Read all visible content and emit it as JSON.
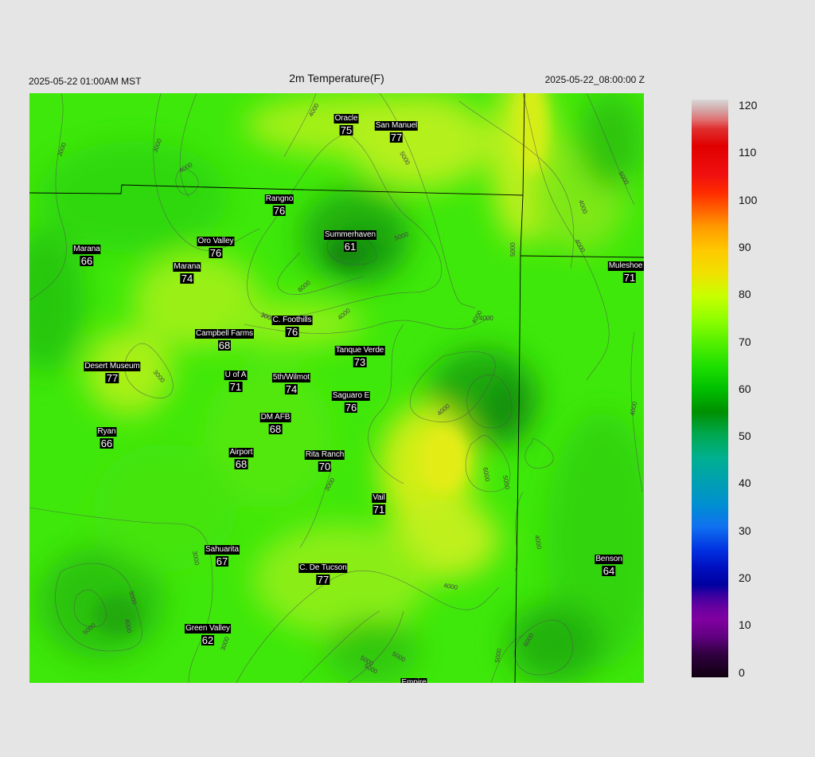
{
  "header": {
    "local_time": "2025-05-22 01:00AM MST",
    "title": "2m Temperature(F)",
    "utc_time": "2025-05-22_08:00:00 Z"
  },
  "colorbar": {
    "ticks": [
      "120",
      "110",
      "100",
      "90",
      "80",
      "70",
      "60",
      "50",
      "40",
      "30",
      "20",
      "10",
      "0"
    ]
  },
  "stations": [
    {
      "name": "Oracle",
      "value": "75"
    },
    {
      "name": "San Manuel",
      "value": "77"
    },
    {
      "name": "Rangno",
      "value": "76"
    },
    {
      "name": "Summerhaven",
      "value": "61"
    },
    {
      "name": "Oro Valley",
      "value": "76"
    },
    {
      "name": "Marana",
      "value": "66"
    },
    {
      "name": "Marana",
      "value": "74"
    },
    {
      "name": "Muleshoe R",
      "value": "71"
    },
    {
      "name": "C. Foothills",
      "value": "76"
    },
    {
      "name": "Campbell Farms",
      "value": "68"
    },
    {
      "name": "Tanque Verde",
      "value": "73"
    },
    {
      "name": "Desert Museum",
      "value": "77"
    },
    {
      "name": "U of A",
      "value": "71"
    },
    {
      "name": "5th/Wilmot",
      "value": "74"
    },
    {
      "name": "Saguaro E",
      "value": "76"
    },
    {
      "name": "DM AFB",
      "value": "68"
    },
    {
      "name": "Ryan",
      "value": "66"
    },
    {
      "name": "Airport",
      "value": "68"
    },
    {
      "name": "Rita Ranch",
      "value": "70"
    },
    {
      "name": "Vail",
      "value": "71"
    },
    {
      "name": "Sahuarita",
      "value": "67"
    },
    {
      "name": "C. De Tucson",
      "value": "77"
    },
    {
      "name": "Benson",
      "value": "64"
    },
    {
      "name": "Green Valley",
      "value": "62"
    },
    {
      "name": "Empire",
      "value": ""
    }
  ],
  "contour_labels": [
    "3000",
    "3000",
    "4000",
    "4000",
    "4000",
    "5000",
    "6000",
    "5000",
    "4000",
    "4000",
    "5000",
    "6000",
    "3000",
    "3000",
    "4000",
    "4000",
    "5000",
    "5000",
    "3000",
    "3000",
    "4000",
    "5000",
    "5000",
    "4000",
    "4000",
    "5000",
    "5000",
    "6000",
    "3000",
    "5000",
    "4000",
    "3000",
    "4000",
    "3000"
  ]
}
